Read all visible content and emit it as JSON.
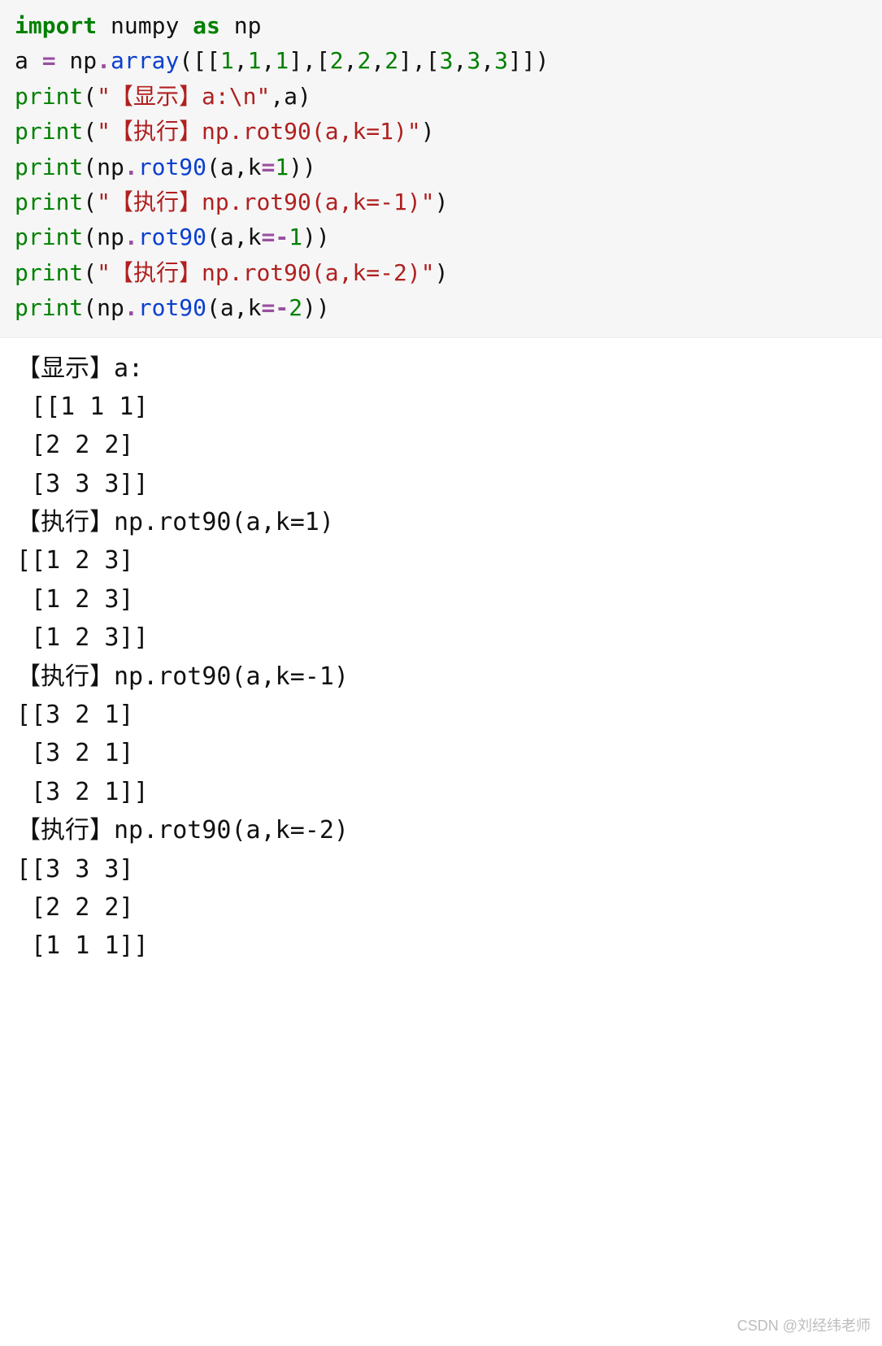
{
  "code": {
    "l1_import": "import",
    "l1_numpy": " numpy ",
    "l1_as": "as",
    "l1_np": " np",
    "l2_a": "a ",
    "l2_eq": "=",
    "l2_sp": " np",
    "l2_dot": ".",
    "l2_array": "array",
    "l2_open": "([[",
    "l2_n1a": "1",
    "l2_c": ",",
    "l2_n1b": "1",
    "l2_n1c": "1",
    "l2_mid1": "],[",
    "l2_n2a": "2",
    "l2_n2b": "2",
    "l2_n2c": "2",
    "l2_mid2": "],[",
    "l2_n3a": "3",
    "l2_n3b": "3",
    "l2_n3c": "3",
    "l2_close": "]])",
    "l3_print": "print",
    "l3_open": "(",
    "l3_str": "\"【显示】a:\\n\"",
    "l3_c": ",a)",
    "l4_str": "\"【执行】np.rot90(a,k=1)\"",
    "l4_close": ")",
    "l5_open": "(np",
    "l5_rot": "rot90",
    "l5_args": "(a,k",
    "l5_eq": "=",
    "l5_k1": "1",
    "l5_close": "))",
    "l6_str": "\"【执行】np.rot90(a,k=-1)\"",
    "l7_km1": "-",
    "l7_k1": "1",
    "l8_str": "\"【执行】np.rot90(a,k=-2)\"",
    "l9_k2": "2"
  },
  "output": {
    "line1": "【显示】a:",
    "line2": " [[1 1 1]",
    "line3": " [2 2 2]",
    "line4": " [3 3 3]]",
    "line5": "【执行】np.rot90(a,k=1)",
    "line6": "[[1 2 3]",
    "line7": " [1 2 3]",
    "line8": " [1 2 3]]",
    "line9": "【执行】np.rot90(a,k=-1)",
    "line10": "[[3 2 1]",
    "line11": " [3 2 1]",
    "line12": " [3 2 1]]",
    "line13": "【执行】np.rot90(a,k=-2)",
    "line14": "[[3 3 3]",
    "line15": " [2 2 2]",
    "line16": " [1 1 1]]"
  },
  "watermark": "CSDN @刘经纬老师"
}
